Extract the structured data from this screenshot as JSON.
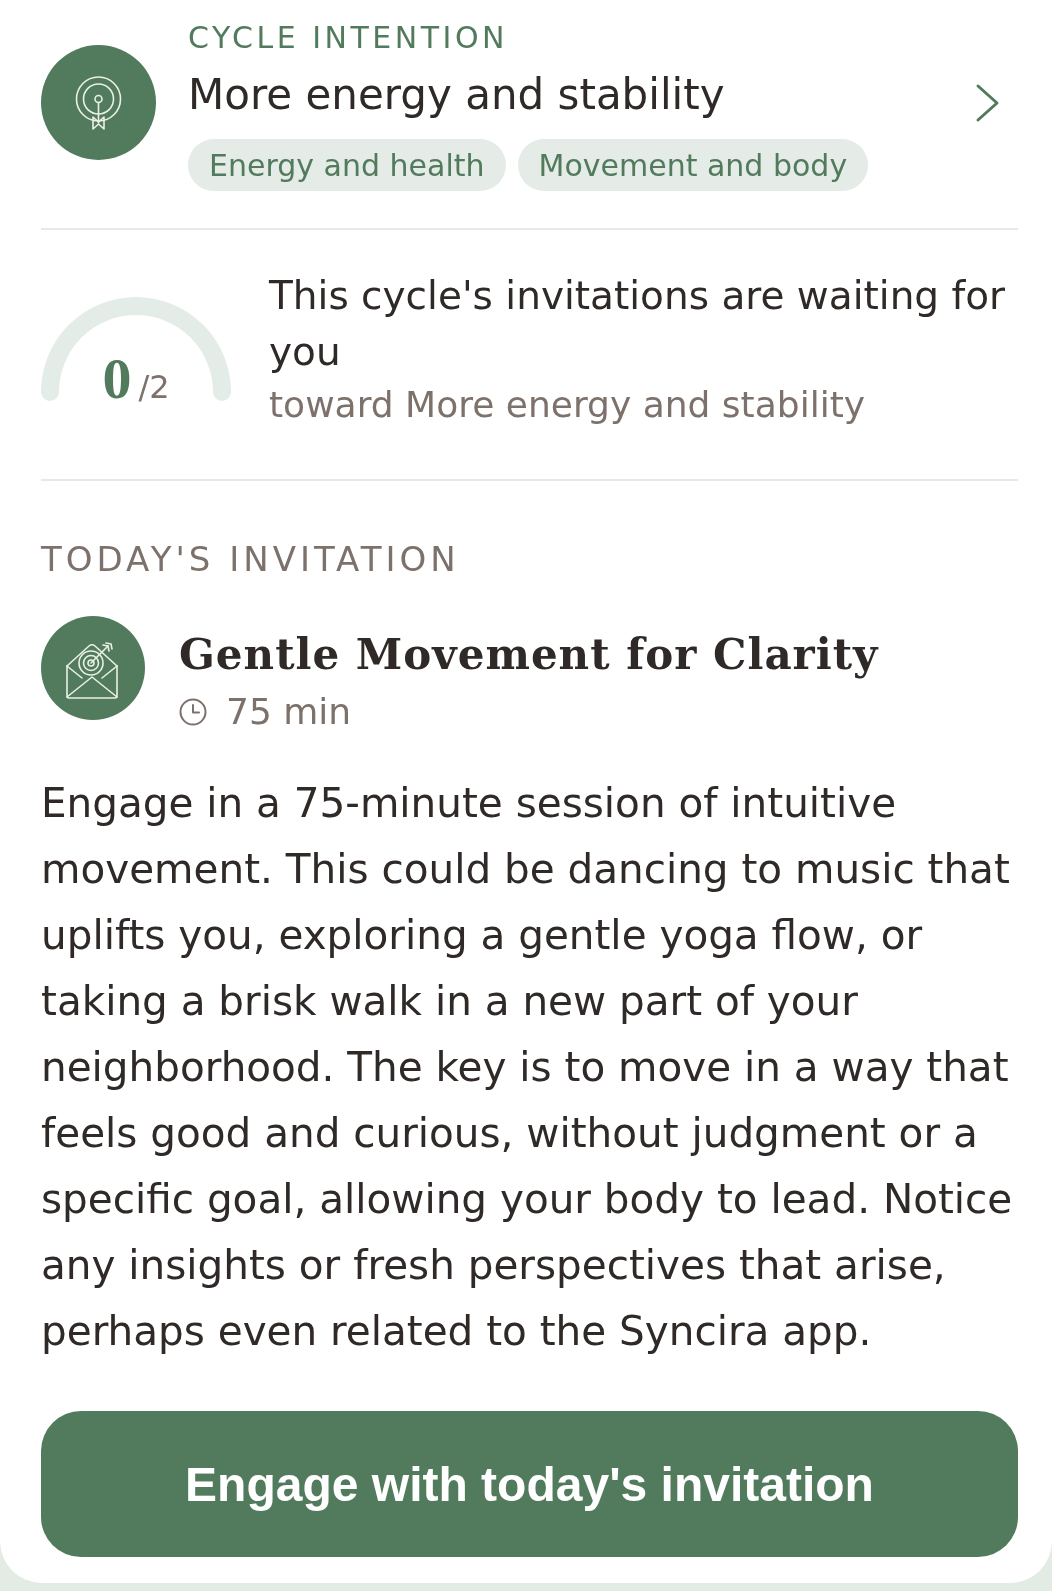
{
  "cycle_intention": {
    "label": "CYCLE INTENTION",
    "title": "More energy and stability",
    "tags": [
      "Energy and health",
      "Movement and body"
    ]
  },
  "progress": {
    "count": "0",
    "total": "/2",
    "heading": "This cycle's invitations are waiting for you",
    "subtitle": "toward More energy and stability"
  },
  "todays_invitation": {
    "label": "TODAY'S INVITATION",
    "title": "Gentle Movement for Clarity",
    "duration": "75 min",
    "description": "Engage in a 75-minute session of intuitive movement. This could be dancing to music that uplifts you, exploring a gentle yoga flow, or taking a brisk walk in a new part of your neighborhood. The key is to move in a way that feels good and curious, without judgment or a specific goal, allowing your body to lead. Notice any insights or fresh perspectives that arise, perhaps even related to the Syncira app.",
    "button": "Engage with today's invitation"
  }
}
